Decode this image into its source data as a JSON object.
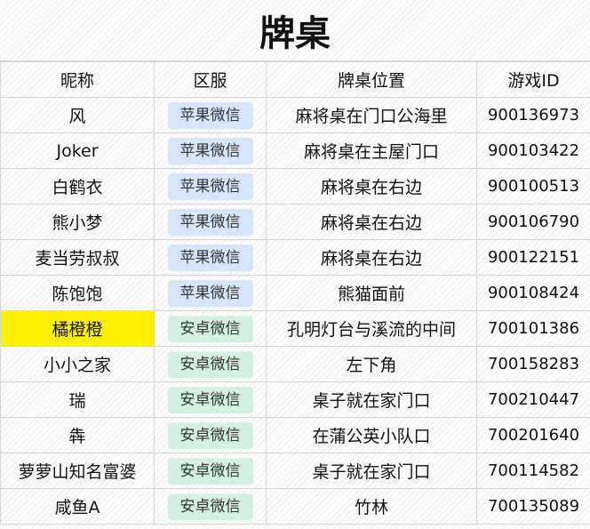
{
  "title": "牌桌",
  "headers": [
    "昵称",
    "区服",
    "牌桌位置",
    "游戏ID"
  ],
  "colors": {
    "highlight": "#fff200",
    "tag_apple": "#d5e6fb",
    "tag_android": "#d4f0e3"
  },
  "rows": [
    {
      "name": "风",
      "server": "苹果微信",
      "location": "麻将桌在门口公海里",
      "game_id": "900136973"
    },
    {
      "name": "Joker",
      "server": "苹果微信",
      "location": "麻将桌在主屋门口",
      "game_id": "900103422"
    },
    {
      "name": "白鹤衣",
      "server": "苹果微信",
      "location": "麻将桌在右边",
      "game_id": "900100513"
    },
    {
      "name": "熊小梦",
      "server": "苹果微信",
      "location": "麻将桌在右边",
      "game_id": "900106790"
    },
    {
      "name": "麦当劳叔叔",
      "server": "苹果微信",
      "location": "麻将桌在右边",
      "game_id": "900122151"
    },
    {
      "name": "陈饱饱",
      "server": "苹果微信",
      "location": "熊猫面前",
      "game_id": "900108424"
    },
    {
      "name": "橘橙橙",
      "server": "安卓微信",
      "location": "孔明灯台与溪流的中间",
      "game_id": "700101386"
    },
    {
      "name": "小小之家",
      "server": "安卓微信",
      "location": "左下角",
      "game_id": "700158283"
    },
    {
      "name": "瑞",
      "server": "安卓微信",
      "location": "桌子就在家门口",
      "game_id": "700210447"
    },
    {
      "name": "犇",
      "server": "安卓微信",
      "location": "在蒲公英小队口",
      "game_id": "700201640"
    },
    {
      "name": "萝萝山知名富婆",
      "server": "安卓微信",
      "location": "桌子就在家门口",
      "game_id": "700114582"
    },
    {
      "name": "咸鱼A",
      "server": "安卓微信",
      "location": "竹林",
      "game_id": "700135089"
    }
  ]
}
